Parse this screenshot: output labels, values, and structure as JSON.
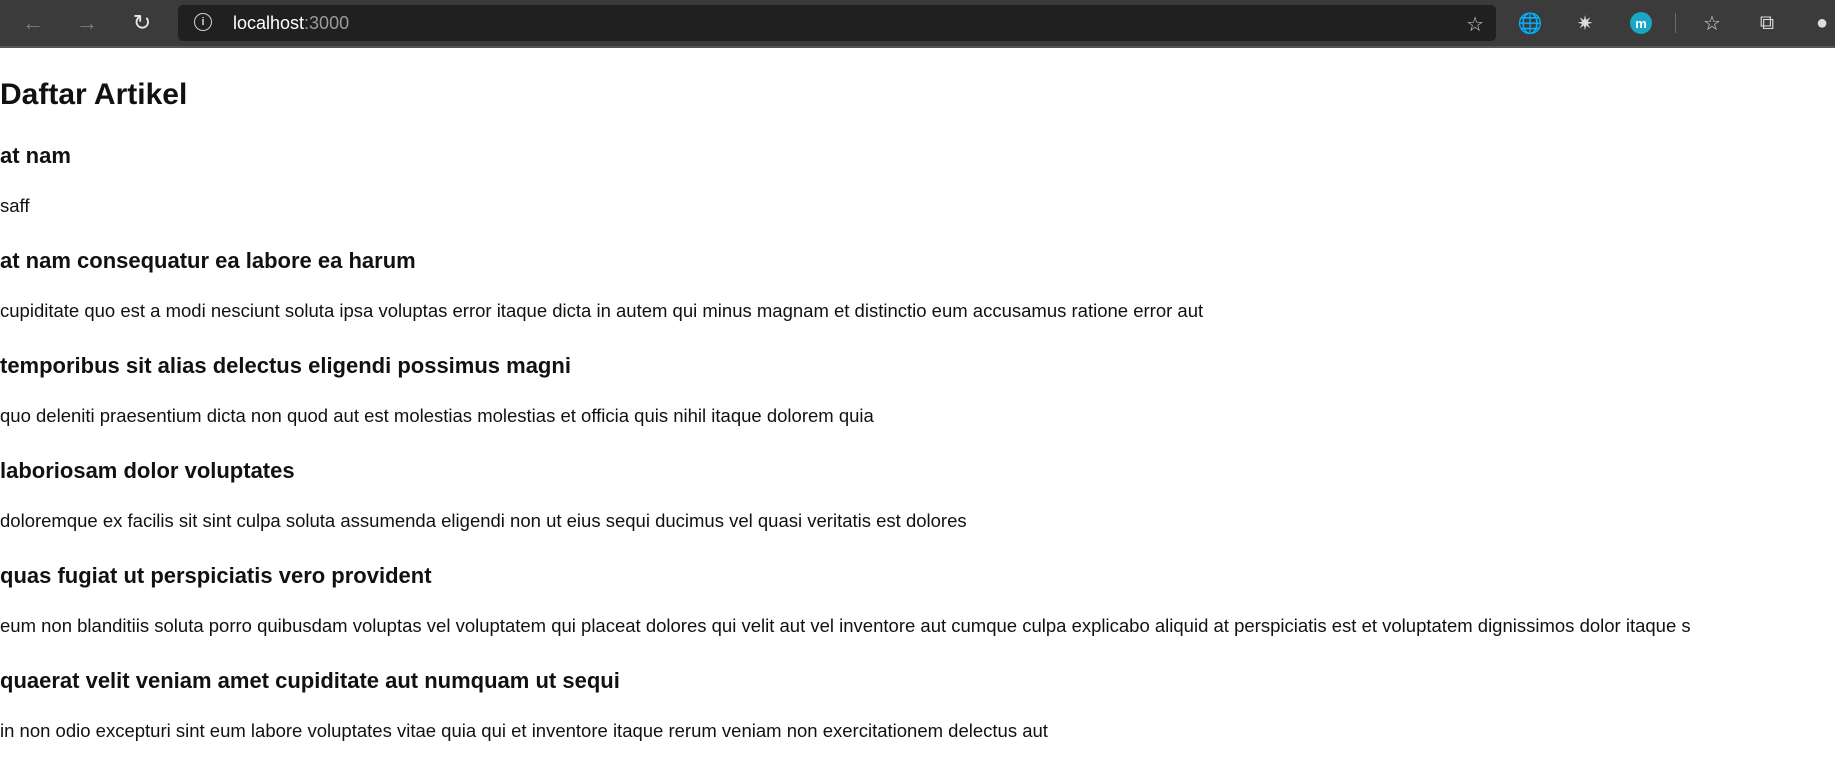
{
  "browser": {
    "url_host": "localhost",
    "url_port": ":3000",
    "back_icon": "arrow-left-icon",
    "forward_icon": "arrow-right-icon",
    "refresh_icon": "refresh-icon",
    "info_icon": "info-icon",
    "profile_initial": "m"
  },
  "page": {
    "title": "Daftar Artikel",
    "articles": [
      {
        "title": "at nam",
        "body": "saff"
      },
      {
        "title": "at nam consequatur ea labore ea harum",
        "body": "cupiditate quo est a modi nesciunt soluta ipsa voluptas error itaque dicta in autem qui minus magnam et distinctio eum accusamus ratione error aut"
      },
      {
        "title": "temporibus sit alias delectus eligendi possimus magni",
        "body": "quo deleniti praesentium dicta non quod aut est molestias molestias et officia quis nihil itaque dolorem quia"
      },
      {
        "title": "laboriosam dolor voluptates",
        "body": "doloremque ex facilis sit sint culpa soluta assumenda eligendi non ut eius sequi ducimus vel quasi veritatis est dolores"
      },
      {
        "title": "quas fugiat ut perspiciatis vero provident",
        "body": "eum non blanditiis soluta porro quibusdam voluptas vel voluptatem qui placeat dolores qui velit aut vel inventore aut cumque culpa explicabo aliquid at perspiciatis est et voluptatem dignissimos dolor itaque s"
      },
      {
        "title": "quaerat velit veniam amet cupiditate aut numquam ut sequi",
        "body": "in non odio excepturi sint eum labore voluptates vitae quia qui et inventore itaque rerum veniam non exercitationem delectus aut"
      }
    ]
  }
}
